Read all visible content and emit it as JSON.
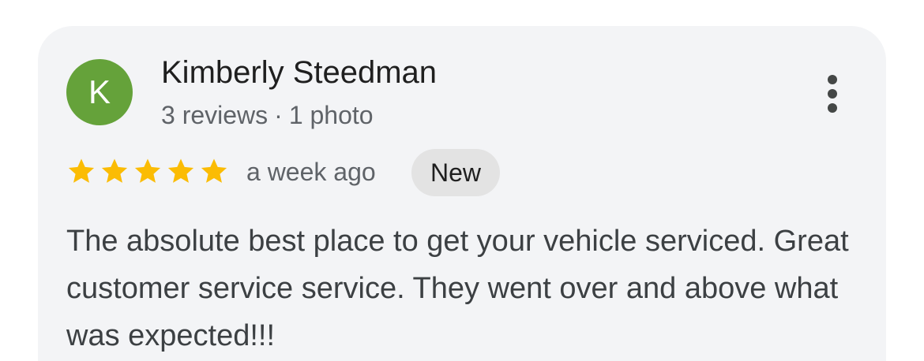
{
  "review": {
    "avatar_initial": "K",
    "avatar_color": "#65a23a",
    "author_name": "Kimberly Steedman",
    "reviews_count_text": "3 reviews",
    "meta_separator": "·",
    "photos_count_text": "1 photo",
    "rating": 5,
    "rating_max": 5,
    "star_color": "#fbbc04",
    "time_text": "a week ago",
    "badge_text": "New",
    "body_text": "The absolute best place to get your vehicle serviced. Great customer service service. They went over and above what was expected!!!"
  },
  "icons": {
    "more": "more-vert-icon",
    "star": "star-icon"
  }
}
